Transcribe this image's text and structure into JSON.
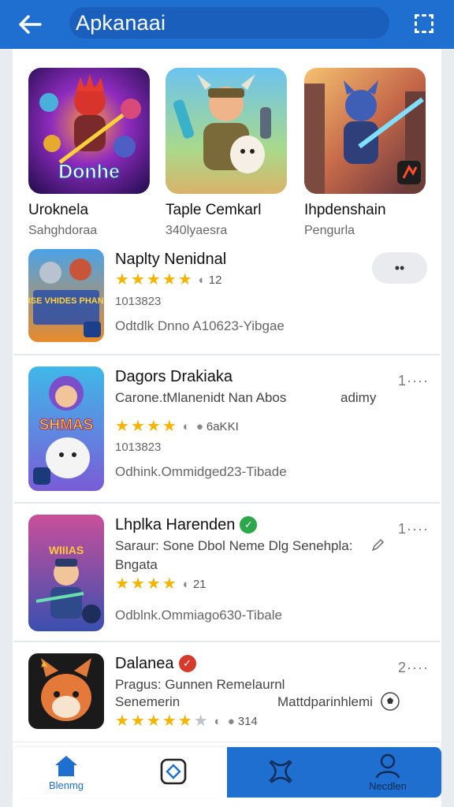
{
  "header": {
    "title": "Apkanaai",
    "accent": "#1f6fd0"
  },
  "featured": [
    {
      "title": "Uroknela",
      "subtitle": "Sahghdoraa",
      "art_text": "Donhe"
    },
    {
      "title": "Taple Cemkarl",
      "subtitle": "340lyaesra"
    },
    {
      "title": "Ihpdenshain",
      "subtitle": "Pengurla"
    }
  ],
  "list": [
    {
      "name": "Naplty Nenidnal",
      "rating": 5,
      "rating_count": "12",
      "version": "1013823",
      "meta": "Odtdlk Dnno  A10623-Yibgae",
      "action": "••",
      "art_text": "LOISE VHIDES PHANCH"
    },
    {
      "name": "Dagors Drakiaka",
      "desc": "Carone.tMlanenidt  Nan Abos",
      "desc_right": "adimy",
      "rating": 4,
      "rating_count": "6aKKI",
      "version": "1013823",
      "meta": "Odhink.Ommidged23-Tibade",
      "more": "1····",
      "art_text": "SHMAS"
    },
    {
      "name": "Lhplka Harenden",
      "desc": "Saraur: Sone Dbol Neme Dlg Senehpla:",
      "desc2": "Bngata",
      "rating": 4,
      "rating_count": "21",
      "meta": "Odblnk.Ommiago630-Tibale",
      "more": "1····",
      "art_text": "WIIIAS"
    },
    {
      "name": "Dalanea",
      "desc": "Pragus: Gunnen Remelaurnl",
      "desc2": "Senemerin",
      "desc2_right": "Mattdparinhlemi",
      "rating": 5,
      "rating_count": "314",
      "more": "2····"
    }
  ],
  "nav": [
    {
      "label": "Blenmg",
      "icon": "home-icon"
    },
    {
      "label": "",
      "icon": "apps-icon"
    },
    {
      "label": "",
      "icon": "games-icon"
    },
    {
      "label": "Necdlen",
      "icon": "profile-icon"
    }
  ]
}
